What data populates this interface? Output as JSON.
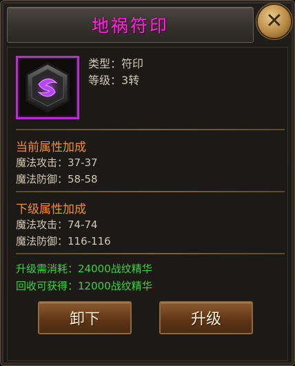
{
  "dialog": {
    "title": "地祸符印",
    "close_icon": "close-icon"
  },
  "item": {
    "icon": "purple-rune-sigil-icon",
    "type_label": "类型：",
    "type_value": "符印",
    "level_label": "等级：",
    "level_value": "3转"
  },
  "current": {
    "heading": "当前属性加成",
    "stats": [
      {
        "label": "魔法攻击：",
        "value": "37-37"
      },
      {
        "label": "魔法防御：",
        "value": "58-58"
      }
    ]
  },
  "next": {
    "heading": "下级属性加成",
    "stats": [
      {
        "label": "魔法攻击：",
        "value": "74-74"
      },
      {
        "label": "魔法防御：",
        "value": "116-116"
      }
    ]
  },
  "cost": {
    "upgrade_label": "升级需消耗：",
    "upgrade_value": "24000战纹精华",
    "recycle_label": "回收可获得：",
    "recycle_value": "12000战纹精华"
  },
  "buttons": {
    "unequip": "卸下",
    "upgrade": "升级"
  },
  "colors": {
    "title": "#ff28d8",
    "section_heading": "#ee8f35",
    "cost_text": "#3fd33f",
    "frame": "#b532c8"
  }
}
